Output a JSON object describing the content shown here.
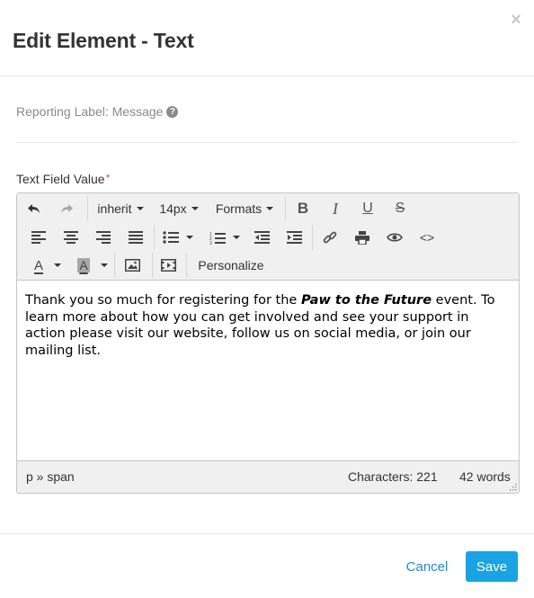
{
  "modal": {
    "title": "Edit Element - Text",
    "close_symbol": "×"
  },
  "reporting": {
    "label": "Reporting Label: Message",
    "help_symbol": "?"
  },
  "field": {
    "label": "Text Field Value",
    "required_marker": "*"
  },
  "toolbar": {
    "font_family": "inherit",
    "font_size": "14px",
    "formats": "Formats",
    "bold": "B",
    "italic": "I",
    "underline": "U",
    "strike": "S",
    "text_color": "A",
    "bg_color": "A",
    "personalize": "Personalize",
    "code": "<>"
  },
  "content": {
    "before": "Thank you so much for registering for the ",
    "emphasis": "Paw to the Future",
    "after": " event. To learn more about how you can get involved and see your support in action please visit our website, follow us on social media, or join our mailing list."
  },
  "status": {
    "path": "p » span",
    "characters": "Characters: 221",
    "words": "42 words"
  },
  "footer": {
    "cancel": "Cancel",
    "save": "Save"
  },
  "colors": {
    "accent": "#1aa3e3",
    "link": "#1a8fd6",
    "required": "#d9534f"
  }
}
